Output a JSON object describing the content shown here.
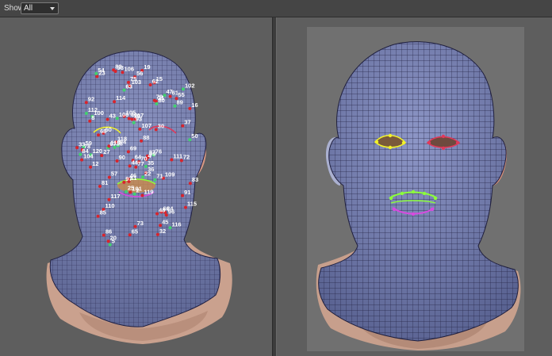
{
  "toolbar": {
    "show_label": "Show",
    "show_value": "All"
  },
  "left_viewport": {
    "labels": [
      "2",
      "8",
      "11",
      "4",
      "5",
      "15",
      "17",
      "21",
      "22",
      "23",
      "12",
      "16",
      "25",
      "30",
      "40",
      "88",
      "94",
      "10",
      "99",
      "96",
      "100",
      "103",
      "104",
      "48",
      "50",
      "46",
      "44",
      "43",
      "47",
      "20",
      "24",
      "19",
      "18",
      "27",
      "32",
      "33",
      "35",
      "36",
      "37",
      "45",
      "54",
      "55",
      "56",
      "57",
      "59",
      "60",
      "61",
      "62",
      "63",
      "64",
      "65",
      "66",
      "67",
      "68",
      "69",
      "70",
      "71",
      "72",
      "73",
      "75",
      "76",
      "77",
      "78",
      "79",
      "80",
      "81",
      "82",
      "83",
      "84",
      "85",
      "86",
      "87",
      "89",
      "90",
      "91",
      "92",
      "93",
      "97",
      "98",
      "101",
      "102",
      "105",
      "106",
      "107",
      "108",
      "109",
      "110",
      "111",
      "112",
      "113",
      "114",
      "115",
      "116",
      "117",
      "118",
      "119",
      "120"
    ]
  },
  "colors": {
    "background": "#5c5c5c",
    "mesh": "#2c2c55",
    "head_fill": "#7c84b0",
    "skin": "#d9a68a",
    "eye_yellow": "#f2f22a",
    "eye_red": "#e0395a",
    "lips_green": "#8cff3a",
    "lips_magenta": "#d84adf",
    "marker_red": "#d8242c",
    "marker_green": "#42d16f"
  }
}
